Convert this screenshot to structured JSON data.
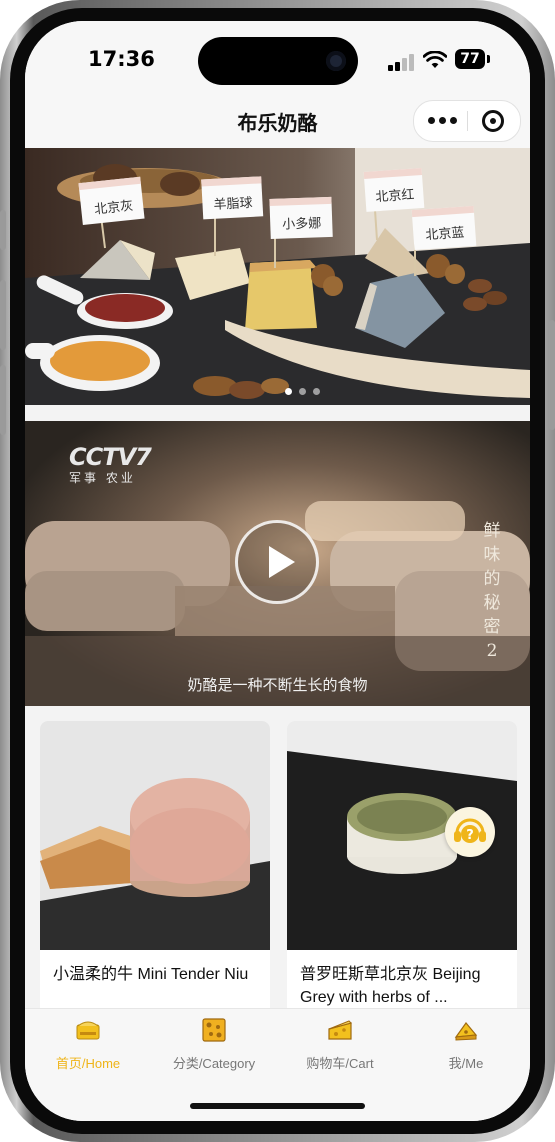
{
  "status_bar": {
    "time": "17:36",
    "battery": "77"
  },
  "nav": {
    "title": "布乐奶酪"
  },
  "banner": {
    "flags": [
      "北京灰",
      "羊脂球",
      "小多娜",
      "北京红",
      "北京蓝"
    ],
    "page_count": 3,
    "active_page": 1
  },
  "video": {
    "channel_logo": "CCTV7",
    "channel_sub": "军事 农业",
    "side_title": "鲜味的秘密2",
    "side_title_chars": [
      "鲜",
      "味",
      "的",
      "秘",
      "密",
      "2"
    ],
    "subtitle": "奶酪是一种不断生长的食物"
  },
  "products": [
    {
      "name": "小温柔的牛 Mini Tender Niu"
    },
    {
      "name": "普罗旺斯草北京灰 Beijing Grey with herbs of ..."
    }
  ],
  "tabs": [
    {
      "label": "首页/Home",
      "icon": "home-cheese-shop-icon",
      "active": true
    },
    {
      "label": "分类/Category",
      "icon": "cheese-block-icon",
      "active": false
    },
    {
      "label": "购物车/Cart",
      "icon": "cheese-wedge-icon",
      "active": false
    },
    {
      "label": "我/Me",
      "icon": "cheese-slice-icon",
      "active": false
    }
  ],
  "colors": {
    "accent": "#efb51a",
    "tab_inactive": "#777777",
    "nav_bg": "#f7f7f7"
  }
}
